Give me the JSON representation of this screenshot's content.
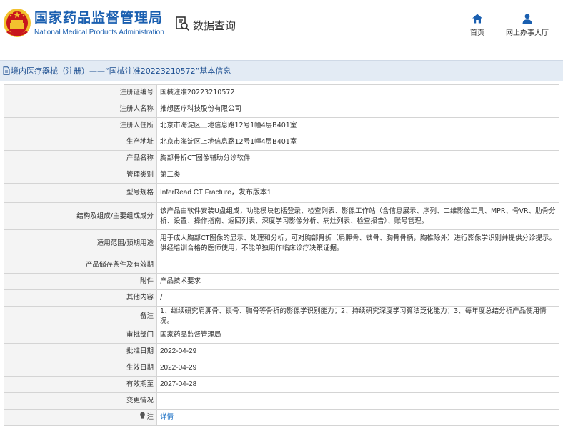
{
  "header": {
    "site_name_cn": "国家药品监督管理局",
    "site_name_en": "National Medical Products Administration",
    "query_label": "数据查询",
    "nav": {
      "home_label": "首页",
      "office_label": "网上办事大厅"
    }
  },
  "title": "境内医疗器械（注册）——“国械注准20223210572”基本信息",
  "rows": [
    {
      "label": "注册证编号",
      "value": "国械注准20223210572"
    },
    {
      "label": "注册人名称",
      "value": "推想医疗科技股份有限公司"
    },
    {
      "label": "注册人住所",
      "value": "北京市海淀区上地信息路12号1幢4层B401室"
    },
    {
      "label": "生产地址",
      "value": "北京市海淀区上地信息路12号1幢4层B401室"
    },
    {
      "label": "产品名称",
      "value": "胸部骨折CT图像辅助分诊软件"
    },
    {
      "label": "管理类别",
      "value": "第三类"
    },
    {
      "label": "型号规格",
      "value": "InferRead CT Fracture，发布版本1"
    },
    {
      "label": "结构及组成/主要组成成分",
      "value": "该产品由软件安装U盘组成，功能模块包括登录、检查列表、影像工作站（含信息展示、序列、二维影像工具、MPR、骨VR、肋骨分析、设置、操作指南、返回列表、深度学习影像分析、病灶列表、检查报告）、账号管理。"
    },
    {
      "label": "适用范围/预期用途",
      "value": "用于成人胸部CT图像的显示、处理和分析，可对胸部骨折（肩胛骨、锁骨、胸骨骨柄，胸椎除外）进行影像学识别并提供分诊提示。供经培训合格的医师使用，不能单独用作临床诊疗决策证据。"
    },
    {
      "label": "产品储存条件及有效期",
      "value": ""
    },
    {
      "label": "附件",
      "value": "产品技术要求"
    },
    {
      "label": "其他内容",
      "value": "/"
    },
    {
      "label": "备注",
      "value": "1、继续研究肩胛骨、锁骨、胸骨等骨折的影像学识别能力；2、持续研究深度学习算法泛化能力；3、每年度总结分析产品使用情况。"
    },
    {
      "label": "审批部门",
      "value": "国家药品监督管理局"
    },
    {
      "label": "批准日期",
      "value": "2022-04-29"
    },
    {
      "label": "生效日期",
      "value": "2022-04-29"
    },
    {
      "label": "有效期至",
      "value": "2027-04-28"
    },
    {
      "label": "变更情况",
      "value": ""
    },
    {
      "label": "注",
      "value": "详情"
    }
  ],
  "colors": {
    "brand_blue": "#1a5fb0",
    "title_bar_bg": "#e3ebf4",
    "logo_red": "#c8161d",
    "logo_gold": "#f2c12e",
    "link_blue": "#1a6fc4"
  },
  "icons": {
    "logo": "national-emblem-icon",
    "query": "document-search-icon",
    "home": "home-icon",
    "office": "user-icon",
    "title": "document-icon",
    "note": "lightbulb-icon"
  }
}
